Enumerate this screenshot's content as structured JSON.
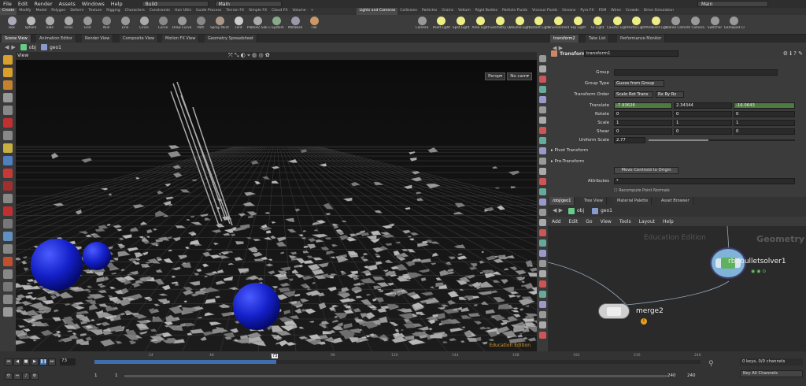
{
  "menubar": {
    "items": [
      "File",
      "Edit",
      "Render",
      "Assets",
      "Windows",
      "Help"
    ],
    "desktop": "Build",
    "context": "Main",
    "right_context": "Main"
  },
  "shelf_tabs": [
    "Create",
    "Modify",
    "Model",
    "Polygon",
    "Deform",
    "Texture",
    "Rigging",
    "Characters",
    "Constraints",
    "Hair Utils",
    "Guide Process",
    "Terrain FX",
    "Simple FX",
    "Cloud FX",
    "Volume",
    "+",
    "Lights and Cameras",
    "Collisions",
    "Particles",
    "Grains",
    "Vellum",
    "Rigid Bodies",
    "Particle Fluids",
    "Viscous Fluids",
    "Oceans",
    "Pyro FX",
    "FEM",
    "Wires",
    "Crowds",
    "Drive Simulation"
  ],
  "shelf_tools_left": [
    {
      "label": "Box",
      "color": "#aab"
    },
    {
      "label": "Sphere",
      "color": "#bbb"
    },
    {
      "label": "Tube",
      "color": "#aaa"
    },
    {
      "label": "Torus",
      "color": "#aaa"
    },
    {
      "label": "Grid",
      "color": "#999"
    },
    {
      "label": "Null",
      "color": "#888"
    },
    {
      "label": "Line",
      "color": "#999"
    },
    {
      "label": "Circle",
      "color": "#aaa"
    },
    {
      "label": "Curve",
      "color": "#888"
    },
    {
      "label": "Draw Curve",
      "color": "#999"
    },
    {
      "label": "Path",
      "color": "#888"
    },
    {
      "label": "Spray Paint",
      "color": "#a98"
    },
    {
      "label": "Font",
      "color": "#ccc"
    },
    {
      "label": "Platonic Solids",
      "color": "#aaa"
    },
    {
      "label": "L-System",
      "color": "#8a8"
    },
    {
      "label": "Metaball",
      "color": "#99a"
    },
    {
      "label": "File",
      "color": "#c96"
    }
  ],
  "shelf_tools_right": [
    {
      "label": "Camera",
      "color": "#999"
    },
    {
      "label": "Point Light",
      "color": "#ee8"
    },
    {
      "label": "Spot Light",
      "color": "#ee8"
    },
    {
      "label": "Area Light",
      "color": "#ee8"
    },
    {
      "label": "Geometry Light",
      "color": "#ee8"
    },
    {
      "label": "Volume Light",
      "color": "#ee8"
    },
    {
      "label": "Distant Light",
      "color": "#ee8"
    },
    {
      "label": "Environment Light",
      "color": "#ee8"
    },
    {
      "label": "Sky Light",
      "color": "#ee8"
    },
    {
      "label": "GI Light",
      "color": "#ee8"
    },
    {
      "label": "Caustic Light",
      "color": "#ee8"
    },
    {
      "label": "Portal Light",
      "color": "#ee8"
    },
    {
      "label": "Ambient Light",
      "color": "#ee8"
    },
    {
      "label": "Stereo Camera",
      "color": "#999"
    },
    {
      "label": "VR Camera",
      "color": "#999"
    },
    {
      "label": "Switcher",
      "color": "#999"
    },
    {
      "label": "Gamepad Camera",
      "color": "#999"
    }
  ],
  "pane_tabs_left": [
    "Scene View",
    "Animation Editor",
    "Render View",
    "Composite View",
    "Motion FX View",
    "Geometry Spreadsheet"
  ],
  "pane_tabs_right": [
    "transform2",
    "Take List",
    "Performance Monitor"
  ],
  "viewport": {
    "path_obj": "obj",
    "path_geo": "geo1",
    "view_label": "View",
    "persp": "Persp▾",
    "cam": "No cam▾",
    "watermark": "Education Edition"
  },
  "params": {
    "node_type": "Transform",
    "node_name": "transform1",
    "group_label": "Group",
    "group_value": "",
    "group_type_label": "Group Type",
    "group_type_value": "Guess from Group",
    "transform_order_label": "Transform Order",
    "transform_order_value": "Scale Rot Trans",
    "rot_order_value": "Rx Ry Rz",
    "translate_label": "Translate",
    "translate": [
      "-7.93626",
      "2.34344",
      "-16.0643"
    ],
    "rotate_label": "Rotate",
    "rotate": [
      "0",
      "0",
      "0"
    ],
    "scale_label": "Scale",
    "scale": [
      "1",
      "1",
      "1"
    ],
    "shear_label": "Shear",
    "shear": [
      "0",
      "0",
      "0"
    ],
    "uniform_scale_label": "Uniform Scale",
    "uniform_scale": "2.77",
    "uniform_scale_fraction": 0.41,
    "pivot_label": "Pivot Transform",
    "pretransform_label": "Pre-Transform",
    "move_centroid_label": "Move Centroid to Origin",
    "attributes_label": "Attributes",
    "attributes_value": "*",
    "recompute_label": "Recompute Point Normals"
  },
  "net_tabs": [
    "/obj/geo1",
    "Tree View",
    "Material Palette",
    "Asset Browser"
  ],
  "net": {
    "path_obj": "obj",
    "path_geo": "geo1",
    "menu": [
      "Add",
      "Edit",
      "Go",
      "View",
      "Tools",
      "Layout",
      "Help"
    ],
    "watermark": "Education Edition",
    "context_label": "Geometry",
    "node1": "rbdbulletsolver1",
    "node2": "merge2"
  },
  "timeline": {
    "frame": "73",
    "ticks": [
      "24",
      "48",
      "72",
      "96",
      "120",
      "144",
      "168",
      "192",
      "216",
      "240"
    ],
    "start": "1",
    "start2": "1",
    "end": "240",
    "end2": "240",
    "current_fraction": 0.3,
    "keys_label": "0 keys, 0/0 channels",
    "key_all_label": "Key All Channels"
  }
}
